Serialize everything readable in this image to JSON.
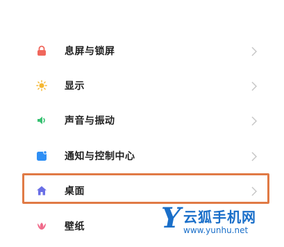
{
  "settings": {
    "items": [
      {
        "label": "息屏与锁屏",
        "icon": "lock-icon",
        "icon_color": "#f0675c"
      },
      {
        "label": "显示",
        "icon": "sun-icon",
        "icon_color": "#f5b731"
      },
      {
        "label": "声音与振动",
        "icon": "speaker-icon",
        "icon_color": "#38c172"
      },
      {
        "label": "通知与控制中心",
        "icon": "notification-icon",
        "icon_color": "#2e8ff5"
      },
      {
        "label": "桌面",
        "icon": "home-icon",
        "icon_color": "#6a6fe6",
        "highlighted": true
      },
      {
        "label": "壁纸",
        "icon": "tulip-icon",
        "icon_color": "#f06a8a"
      }
    ]
  },
  "highlight_color": "#e07a45",
  "watermark": {
    "logo_letter": "Y",
    "brand": "云狐手机网",
    "url": "www.yunhu.net",
    "color": "#1a6fc9"
  }
}
